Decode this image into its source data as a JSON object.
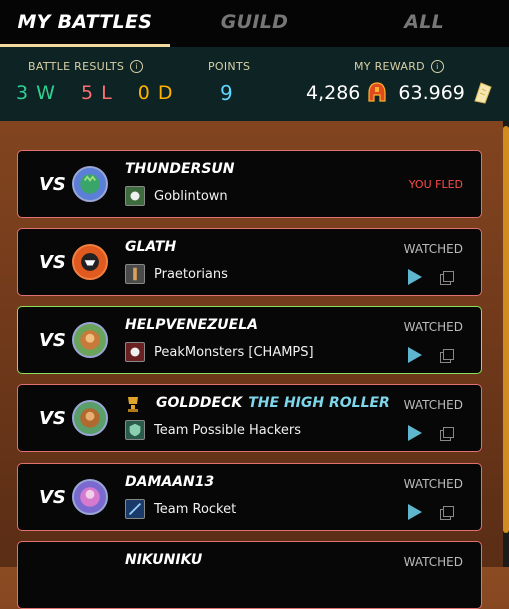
{
  "tabs": [
    {
      "label": "MY BATTLES",
      "active": true
    },
    {
      "label": "GUILD",
      "active": false
    },
    {
      "label": "ALL",
      "active": false
    }
  ],
  "stats": {
    "battle_results_label": "BATTLE RESULTS",
    "wins": "3 W",
    "losses": "5 L",
    "draws": "0 D",
    "points_label": "POINTS",
    "points": "9",
    "reward_label": "MY REWARD",
    "reward_tokens": "4,286",
    "reward_other": "63.969"
  },
  "battles": [
    {
      "vs": "VS",
      "opponent": "THUNDERSUN",
      "title": "",
      "guild": "Goblintown",
      "status": "YOU FLED",
      "win": false
    },
    {
      "vs": "VS",
      "opponent": "GLATH",
      "title": "",
      "guild": "Praetorians",
      "status": "WATCHED",
      "win": false
    },
    {
      "vs": "VS",
      "opponent": "HELPVENEZUELA",
      "title": "",
      "guild": "PeakMonsters [CHAMPS]",
      "status": "WATCHED",
      "win": true
    },
    {
      "vs": "VS",
      "opponent": "GOLDDECK",
      "title": "THE HIGH ROLLER",
      "guild": "Team Possible Hackers",
      "status": "WATCHED",
      "win": false
    },
    {
      "vs": "VS",
      "opponent": "DAMAAN13",
      "title": "",
      "guild": "Team Rocket",
      "status": "WATCHED",
      "win": false
    },
    {
      "vs": "VS",
      "opponent": "NIKUNIKU",
      "title": "",
      "guild": "",
      "status": "WATCHED",
      "win": false
    }
  ],
  "colors": {
    "win_border": "#8be05a",
    "loss_border": "#e17070",
    "accent": "#d08c1f"
  }
}
